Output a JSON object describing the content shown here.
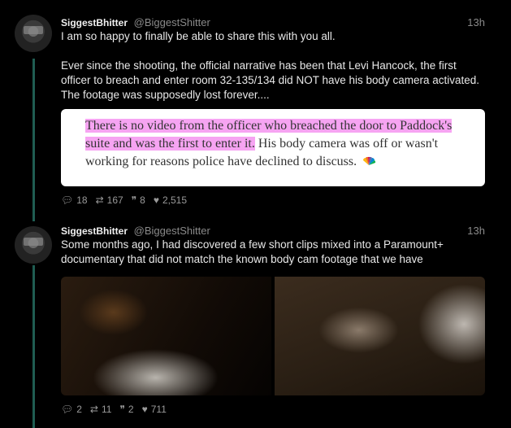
{
  "tweets": [
    {
      "name": "SiggestBhitter",
      "handle": "@BiggestShitter",
      "time": "13h",
      "text_p1": "I am so happy to finally be able to share this with you all.",
      "text_p2": "Ever since the shooting, the official narrative has been that Levi Hancock, the first officer to breach and enter room 32-135/134 did NOT have his body camera activated. The footage was supposedly lost forever....",
      "quote": {
        "highlight": "There is no video from the officer who breached the door to Paddock's suite and was the first to enter it.",
        "rest": " His body camera was off or wasn't working for reasons police have declined to discuss."
      },
      "stats": {
        "replies": "18",
        "retweets": "167",
        "quotes": "8",
        "likes": "2,515"
      }
    },
    {
      "name": "SiggestBhitter",
      "handle": "@BiggestShitter",
      "time": "13h",
      "text_p1": "Some months ago, I had discovered a few short clips mixed into a Paramount+ documentary that did not match the known body cam footage that we have",
      "stats": {
        "replies": "2",
        "retweets": "11",
        "quotes": "2",
        "likes": "711"
      }
    }
  ],
  "icons": {
    "reply": "comment-icon",
    "retweet": "retweet-icon",
    "quote": "quote-icon",
    "like": "heart-icon"
  },
  "colors": {
    "highlight": "#f6a4f2",
    "thread": "#1f5d52"
  }
}
